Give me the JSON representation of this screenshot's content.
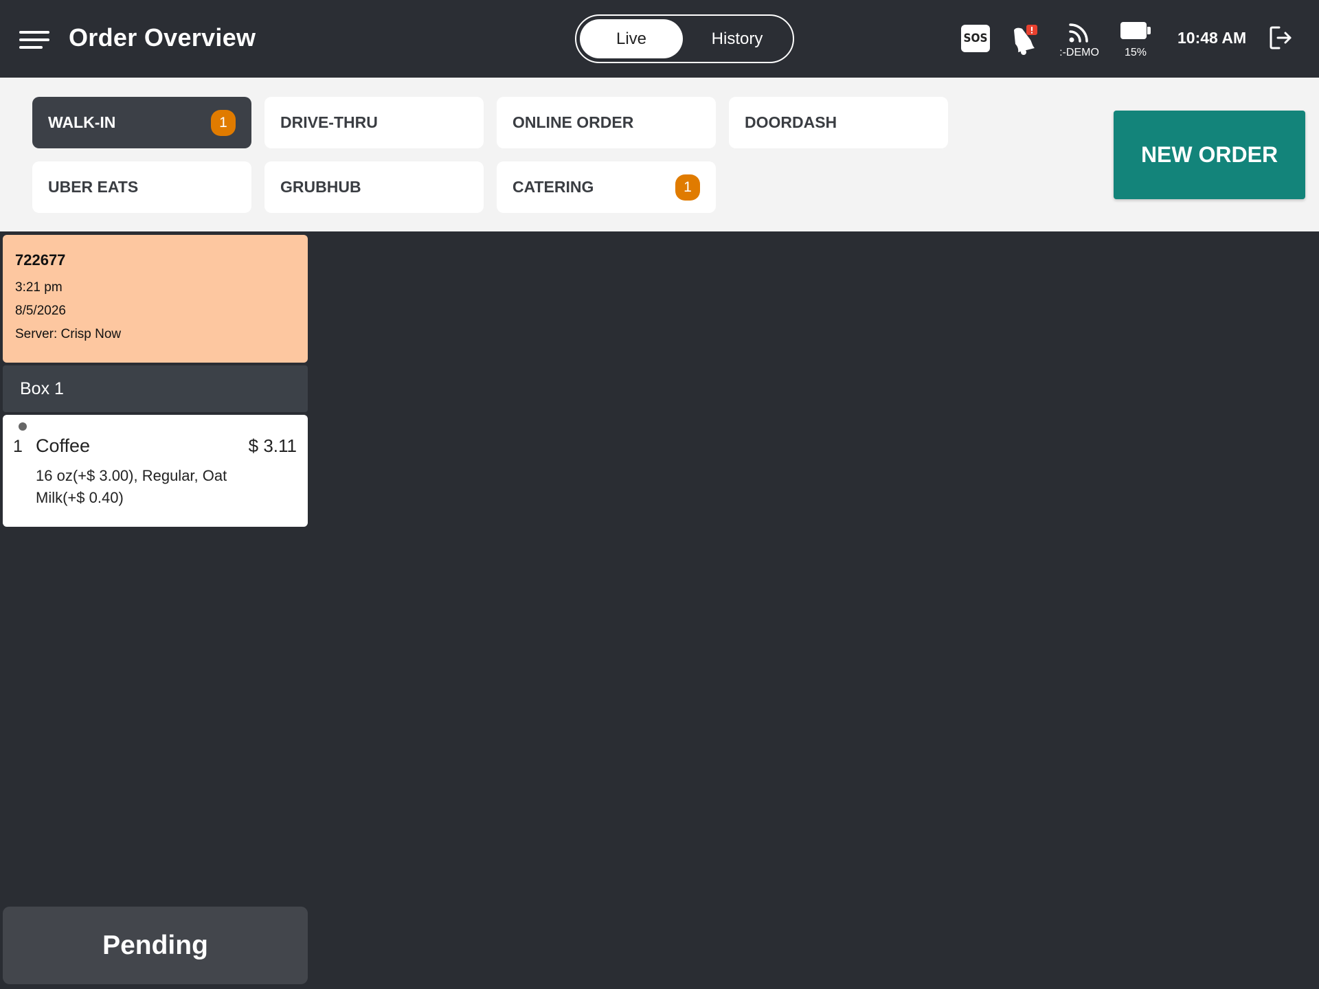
{
  "header": {
    "title": "Order Overview",
    "modes": {
      "live": "Live",
      "history": "History",
      "selected": "Live"
    },
    "sos_label": "SOS",
    "network_label": ":-DEMO",
    "battery_label": "15%",
    "time": "10:48 AM"
  },
  "order_types": [
    {
      "label": "WALK-IN",
      "badge": "1",
      "active": true
    },
    {
      "label": "DRIVE-THRU",
      "badge": "",
      "active": false
    },
    {
      "label": "ONLINE ORDER",
      "badge": "",
      "active": false
    },
    {
      "label": "DOORDASH",
      "badge": "",
      "active": false
    },
    {
      "label": "UBER EATS",
      "badge": "",
      "active": false
    },
    {
      "label": "GRUBHUB",
      "badge": "",
      "active": false
    },
    {
      "label": "CATERING",
      "badge": "1",
      "active": false
    }
  ],
  "new_order_label": "NEW ORDER",
  "ticket": {
    "number": "722677",
    "time": "3:21 pm",
    "date": "8/5/2026",
    "server": "Server: Crisp Now",
    "box_label": "Box 1",
    "items": [
      {
        "qty": "1",
        "name": "Coffee",
        "price": "$ 3.11",
        "modifiers": "16 oz(+$ 3.00), Regular, Oat Milk(+$ 0.40)"
      }
    ]
  },
  "pending_label": "Pending",
  "colors": {
    "background": "#2a2d33",
    "accent_teal": "#13847a",
    "badge_orange": "#e07b00",
    "ticket_peach": "#fdc7a0"
  }
}
